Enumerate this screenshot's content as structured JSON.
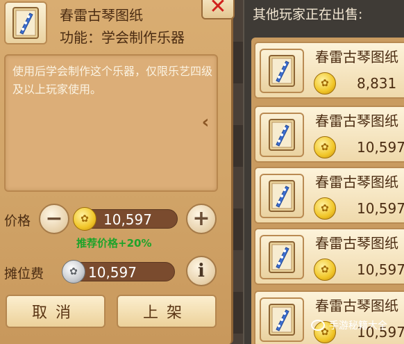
{
  "item": {
    "name": "春雷古琴图纸",
    "function": "功能：学会制作乐器",
    "icon": "blueprint-scroll-icon",
    "description": "使用后学会制作这个乐器，仅限乐艺四级及以上玩家使用。"
  },
  "sell": {
    "price_label": "价格",
    "price_value": "10,597",
    "recommend": "推荐价格+20%",
    "fee_label": "摊位费",
    "fee_value": "10,597",
    "cancel_label": "取消",
    "list_label": "上架"
  },
  "market": {
    "title": "其他玩家正在出售:",
    "listings": [
      {
        "name": "春雷古琴图纸",
        "price": "8,831"
      },
      {
        "name": "春雷古琴图纸",
        "price": "10,597"
      },
      {
        "name": "春雷古琴图纸",
        "price": "10,597"
      },
      {
        "name": "春雷古琴图纸",
        "price": "10,597"
      },
      {
        "name": "春雷古琴图纸",
        "price": "10,597"
      }
    ]
  },
  "watermark": "手游秘籍大全",
  "colors": {
    "panel": "#d1a468",
    "recommend_green": "#1fa32a",
    "close_red": "#d0201c",
    "bar_brown": "#7a4b2e"
  }
}
